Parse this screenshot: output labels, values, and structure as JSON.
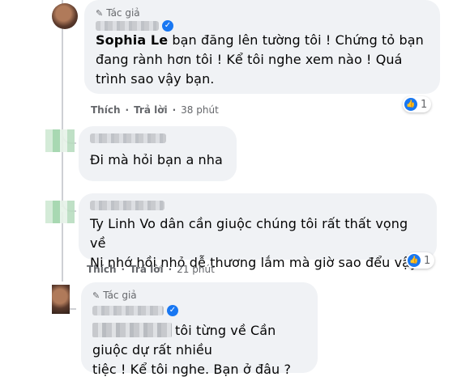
{
  "comments": [
    {
      "author_tag": "Tác giả",
      "mention": "Sophia Le",
      "text_line1": " bạn đăng lên tường tôi ! Chứng tỏ bạn",
      "text_line2": "đang rành hơn tôi ! Kể tôi nghe xem nào ! Quá",
      "text_line3": "trình sao vậy bạn.",
      "like_label": "Thích",
      "reply_label": "Trả lời",
      "time": "38 phút",
      "reaction_count": "1"
    },
    {
      "text_line1": "Đi mà hỏi bạn a nha"
    },
    {
      "text_line1": "Ty Linh Vo dân cần giuộc chúng tôi rất thất vọng về",
      "text_line2": "Ni nhớ hồi nhỏ dễ thương lắm mà giờ sao đểu vậy",
      "like_label": "Thích",
      "reply_label": "Trả lời",
      "time": "21 phút",
      "reaction_count": "1"
    },
    {
      "author_tag": "Tác giả",
      "text_line1": "tôi từng về Cần giuộc dự rất nhiều",
      "text_line2": "tiệc ! Kể tôi nghe. Bạn ở đâu ?"
    }
  ],
  "separator": "·",
  "colors": {
    "accent": "#1877f2",
    "bubble": "#f0f2f5",
    "muted": "#65676b"
  }
}
